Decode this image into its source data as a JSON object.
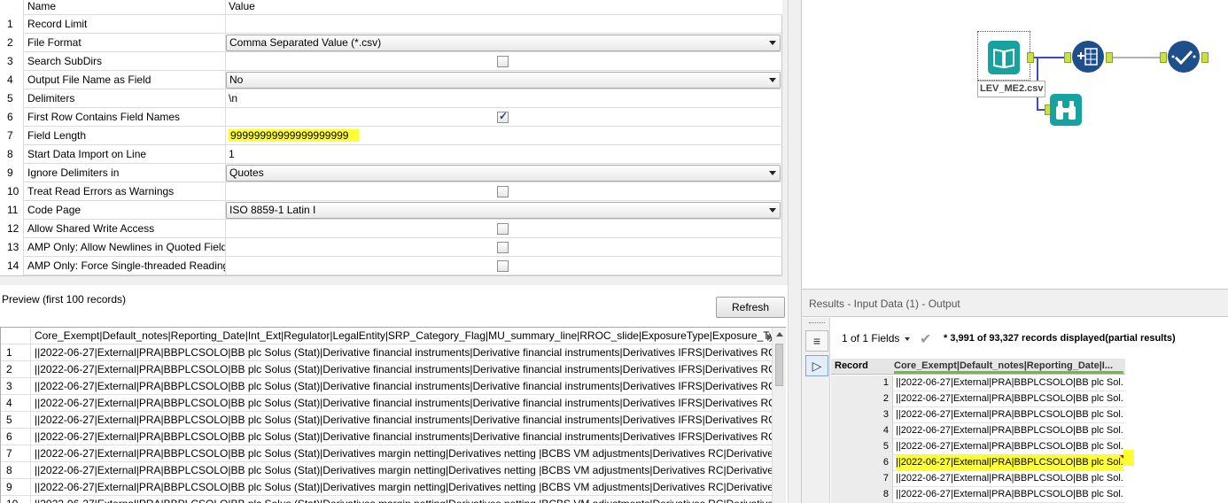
{
  "config": {
    "header": {
      "name": "Name",
      "value": "Value"
    },
    "rows": [
      {
        "num": "1",
        "name": "Record Limit",
        "value": ""
      },
      {
        "num": "2",
        "name": "File Format",
        "value": "Comma Separated Value (*.csv)"
      },
      {
        "num": "3",
        "name": "Search SubDirs",
        "value": ""
      },
      {
        "num": "4",
        "name": "Output File Name as Field",
        "value": "No"
      },
      {
        "num": "5",
        "name": "Delimiters",
        "value": "\\n"
      },
      {
        "num": "6",
        "name": "First Row Contains Field Names",
        "value": ""
      },
      {
        "num": "7",
        "name": "Field Length",
        "value": "99999999999999999999"
      },
      {
        "num": "8",
        "name": "Start Data Import on Line",
        "value": "1"
      },
      {
        "num": "9",
        "name": "Ignore Delimiters in",
        "value": "Quotes"
      },
      {
        "num": "10",
        "name": "Treat Read Errors as Warnings",
        "value": ""
      },
      {
        "num": "11",
        "name": "Code Page",
        "value": "ISO 8859-1 Latin I"
      },
      {
        "num": "12",
        "name": "Allow Shared Write Access",
        "value": ""
      },
      {
        "num": "13",
        "name": "AMP Only: Allow Newlines in Quoted Fields",
        "value": ""
      },
      {
        "num": "14",
        "name": "AMP Only: Force Single-threaded Reading",
        "value": ""
      }
    ],
    "checkboxes": {
      "search_subdirs": false,
      "first_row_names": true,
      "treat_errors": false,
      "shared_write": false,
      "amp_newlines": false,
      "amp_single_thread": false
    },
    "highlight_color": "#ffff33"
  },
  "preview": {
    "label": "Preview (first 100 records)",
    "refresh_label": "Refresh",
    "header": "Core_Exempt|Default_notes|Reporting_Date|Int_Ext|Regulator|LegalEntity|SRP_Category_Flag|MU_summary_line|RROC_slide|ExposureType|Exposure_Type_Group|E",
    "rows": [
      {
        "num": "1",
        "text": "||2022-06-27|External|PRA|BBPLCSOLO|BB plc Solus (Stat)|Derivative financial instruments|Derivative financial instruments|Derivatives IFRS|Derivatives RC|Derivati"
      },
      {
        "num": "2",
        "text": "||2022-06-27|External|PRA|BBPLCSOLO|BB plc Solus (Stat)|Derivative financial instruments|Derivative financial instruments|Derivatives IFRS|Derivatives RC|Derivati"
      },
      {
        "num": "3",
        "text": "||2022-06-27|External|PRA|BBPLCSOLO|BB plc Solus (Stat)|Derivative financial instruments|Derivative financial instruments|Derivatives IFRS|Derivatives RC|Derivati"
      },
      {
        "num": "4",
        "text": "||2022-06-27|External|PRA|BBPLCSOLO|BB plc Solus (Stat)|Derivative financial instruments|Derivative financial instruments|Derivatives IFRS|Derivatives RC|Derivati"
      },
      {
        "num": "5",
        "text": "||2022-06-27|External|PRA|BBPLCSOLO|BB plc Solus (Stat)|Derivative financial instruments|Derivative financial instruments|Derivatives IFRS|Derivatives RC|Derivat"
      },
      {
        "num": "6",
        "text": "||2022-06-27|External|PRA|BBPLCSOLO|BB plc Solus (Stat)|Derivative financial instruments|Derivative financial instruments|Derivatives IFRS|Derivatives RC|Derivat"
      },
      {
        "num": "7",
        "text": "||2022-06-27|External|PRA|BBPLCSOLO|BB plc Solus (Stat)|Derivatives margin netting|Derivatives netting |BCBS VM adjustments|Derivatives RC|Derivatives|Bankin"
      },
      {
        "num": "8",
        "text": "||2022-06-27|External|PRA|BBPLCSOLO|BB plc Solus (Stat)|Derivatives margin netting|Derivatives netting |BCBS VM adjustments|Derivatives RC|Derivatives|Bankin"
      },
      {
        "num": "9",
        "text": "||2022-06-27|External|PRA|BBPLCSOLO|BB plc Solus (Stat)|Derivatives margin netting|Derivatives netting |BCBS VM adjustments|Derivatives RC|Derivatives|Barclay"
      },
      {
        "num": "10",
        "text": "||2022-06-27|External|PRA|BBPLCSOLO|BB plc Solus (Stat)|Derivatives margin netting|Derivatives netting |BCBS VM adjustments|Derivatives RC|Derivatives|Marketa"
      }
    ]
  },
  "canvas": {
    "input_label": "LEV_ME2.csv",
    "icons": {
      "input": "book-icon",
      "formula": "formula-icon",
      "output": "check-icon",
      "browse": "binoculars-icon"
    },
    "connector_color": "#3b4db8",
    "tool_colors": {
      "input": "#17a2a2",
      "formula": "#1f4f8a",
      "output": "#1f4f8a",
      "browse": "#17a2a2"
    }
  },
  "results": {
    "header": "Results - Input Data (1) - Output",
    "fields_label": "1 of 1 Fields",
    "records_info": "* 3,991 of 93,327 records displayed(partial results)",
    "col_record": "Record",
    "col_field": "Core_Exempt|Default_notes|Reporting_Date|I...",
    "rows": [
      {
        "num": "1",
        "text": "||2022-06-27|External|PRA|BBPLCSOLO|BB plc Sol..."
      },
      {
        "num": "2",
        "text": "||2022-06-27|External|PRA|BBPLCSOLO|BB plc Sol..."
      },
      {
        "num": "3",
        "text": "||2022-06-27|External|PRA|BBPLCSOLO|BB plc Sol..."
      },
      {
        "num": "4",
        "text": "||2022-06-27|External|PRA|BBPLCSOLO|BB plc Sol..."
      },
      {
        "num": "5",
        "text": "||2022-06-27|External|PRA|BBPLCSOLO|BB plc Sol..."
      },
      {
        "num": "6",
        "text": "||2022-06-27|External|PRA|BBPLCSOLO|BB plc Sol..."
      },
      {
        "num": "7",
        "text": "||2022-06-27|External|PRA|BBPLCSOLO|BB plc Sol..."
      },
      {
        "num": "8",
        "text": "||2022-06-27|External|PRA|BBPLCSOLO|BB plc Sol..."
      }
    ],
    "highlighted_record": "6"
  }
}
